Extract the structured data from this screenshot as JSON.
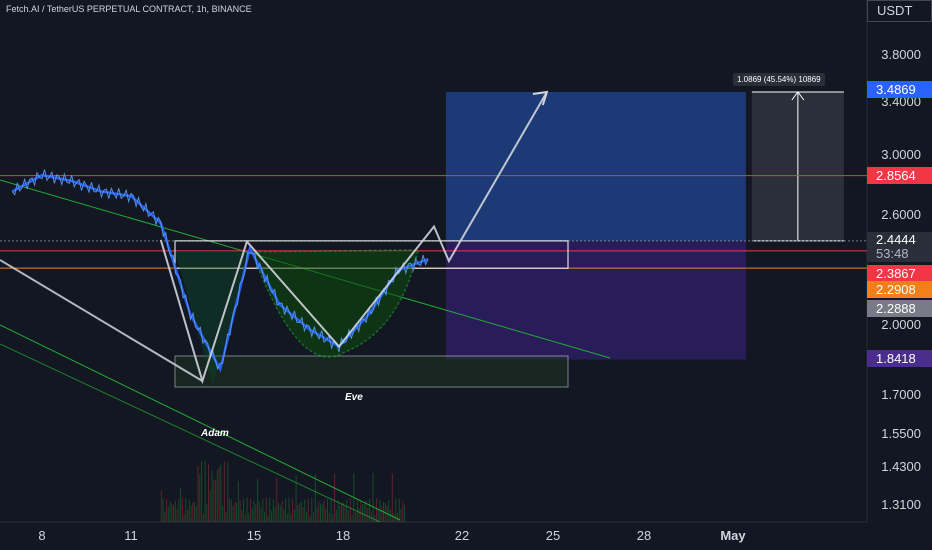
{
  "header": {
    "title": "Fetch.AI / TetherUS PERPETUAL CONTRACT, 1h, BINANCE"
  },
  "axis": {
    "currency": "USDT",
    "price_labels": [
      "3.8000",
      "3.4000",
      "3.0000",
      "2.6000",
      "2.0000",
      "1.7000",
      "1.5500",
      "1.4300",
      "1.3100"
    ],
    "date_labels": [
      "8",
      "11",
      "15",
      "18",
      "22",
      "25",
      "28",
      "May"
    ]
  },
  "price_tags": [
    {
      "value": "3.4869",
      "color": "#2962ff"
    },
    {
      "value": "2.8564",
      "color": "#f23645"
    },
    {
      "value": "2.4444",
      "sub": "53:48",
      "color": "#2a2e39"
    },
    {
      "value": "2.3867",
      "color": "#f23645"
    },
    {
      "value": "2.2908",
      "color": "#f57f17"
    },
    {
      "value": "2.2888",
      "color": "#787b86"
    },
    {
      "value": "1.8418",
      "color": "#4a2d8c"
    }
  ],
  "annotations": {
    "adam": "Adam",
    "eve": "Eve",
    "measure": "1.0869 (45.54%) 10869"
  },
  "colors": {
    "background": "#131722",
    "candles": "#2962ff",
    "green_line": "#22ab37",
    "red_line": "#f23645",
    "orange_line": "#f57f17",
    "pattern": "#d1d4dc",
    "target_zone": "#1e3f80",
    "stop_zone": "#2b1e5e"
  },
  "chart_data": {
    "type": "line",
    "title": "Fetch.AI / TetherUS PERPETUAL CONTRACT, 1h, BINANCE",
    "xlabel": "",
    "ylabel": "USDT",
    "x_ticks": [
      "8",
      "11",
      "15",
      "18",
      "22",
      "25",
      "28",
      "May"
    ],
    "ylim": [
      1.25,
      4.2
    ],
    "scale": "log",
    "grid": false,
    "series": [
      {
        "x": [
          "7",
          "8",
          "9",
          "10",
          "11",
          "12",
          "13",
          "14",
          "15",
          "16",
          "17",
          "18",
          "19",
          "20",
          "21"
        ],
        "values": [
          2.75,
          2.86,
          2.82,
          2.75,
          2.72,
          2.55,
          2.05,
          1.8,
          2.4,
          2.1,
          1.98,
          1.9,
          2.05,
          2.28,
          2.34
        ]
      }
    ],
    "horizontal_levels": [
      2.8564,
      2.4444,
      2.3867,
      2.2908,
      2.2888,
      1.8418
    ],
    "pattern_path": [
      {
        "x": "12",
        "y": 2.45
      },
      {
        "x": "13.4",
        "y": 1.75
      },
      {
        "x": "14.9",
        "y": 2.44
      },
      {
        "x": "18",
        "y": 1.9
      },
      {
        "x": "21.2",
        "y": 2.53
      },
      {
        "x": "21.7",
        "y": 2.33
      },
      {
        "x": "25",
        "y": 3.4869
      }
    ]
  }
}
